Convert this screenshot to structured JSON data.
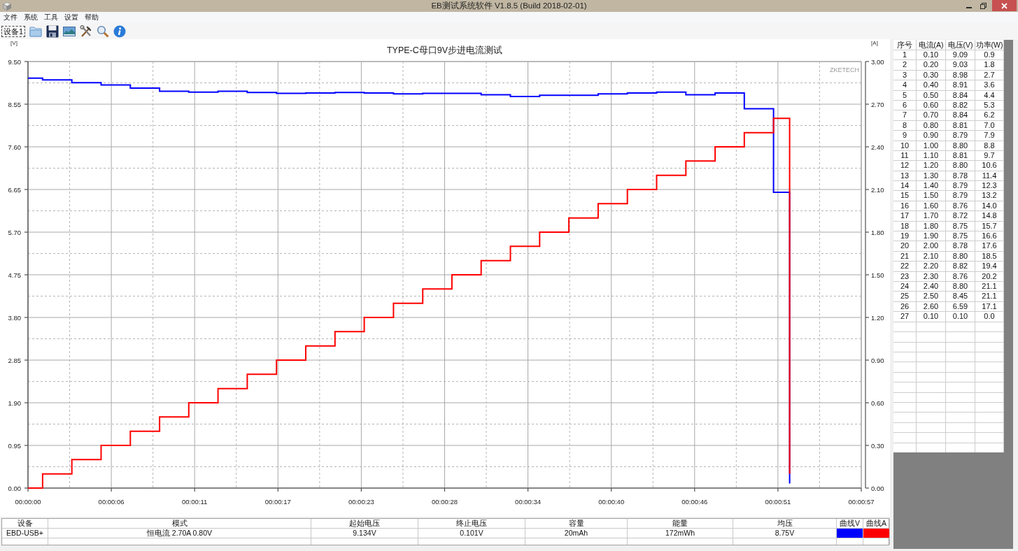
{
  "window": {
    "title": "EB测试系统软件 V1.8.5 (Build 2018-02-01)"
  },
  "menu": [
    "文件",
    "系统",
    "工具",
    "设置",
    "帮助"
  ],
  "toolbar": {
    "device_tab": "设备1"
  },
  "chart": {
    "brand_label": "ZKETECH",
    "chart_data": {
      "type": "line",
      "title": "TYPE-C母口9V步进电流测试",
      "ylabel": "[V]",
      "y2label": "[A]",
      "grid": true,
      "x": [
        0,
        1,
        1,
        3,
        3,
        5,
        5,
        7,
        7,
        9,
        9,
        11,
        11,
        13,
        13,
        15,
        15,
        17,
        17,
        19,
        19,
        21,
        21,
        23,
        23,
        25,
        25,
        27,
        27,
        29,
        29,
        31,
        31,
        33,
        33,
        35,
        35,
        37,
        37,
        39,
        39,
        41,
        41,
        43,
        43,
        45,
        45,
        47,
        47,
        49,
        49,
        51,
        51,
        52.1,
        52.1
      ],
      "series": [
        {
          "color": "#0000ff",
          "values": [
            9.13,
            9.13,
            9.09,
            9.09,
            9.03,
            9.03,
            8.98,
            8.98,
            8.91,
            8.91,
            8.84,
            8.84,
            8.82,
            8.82,
            8.84,
            8.84,
            8.81,
            8.81,
            8.79,
            8.79,
            8.8,
            8.8,
            8.81,
            8.81,
            8.8,
            8.8,
            8.78,
            8.78,
            8.79,
            8.79,
            8.79,
            8.79,
            8.76,
            8.76,
            8.72,
            8.72,
            8.75,
            8.75,
            8.75,
            8.75,
            8.78,
            8.78,
            8.8,
            8.8,
            8.82,
            8.82,
            8.76,
            8.76,
            8.8,
            8.8,
            8.45,
            8.45,
            6.59,
            6.59,
            0.1
          ]
        },
        {
          "color": "#ff0000",
          "axis": "y2",
          "values": [
            0,
            0,
            0.1,
            0.1,
            0.2,
            0.2,
            0.3,
            0.3,
            0.4,
            0.4,
            0.5,
            0.5,
            0.6,
            0.6,
            0.7,
            0.7,
            0.8,
            0.8,
            0.9,
            0.9,
            1,
            1,
            1.1,
            1.1,
            1.2,
            1.2,
            1.3,
            1.3,
            1.4,
            1.4,
            1.5,
            1.5,
            1.6,
            1.6,
            1.7,
            1.7,
            1.8,
            1.8,
            1.9,
            1.9,
            2,
            2,
            2.1,
            2.1,
            2.2,
            2.2,
            2.3,
            2.3,
            2.4,
            2.4,
            2.5,
            2.5,
            2.6,
            2.6,
            0.1
          ]
        }
      ],
      "xlim": [
        0,
        57
      ],
      "ylim": [
        0,
        9.5
      ],
      "y2lim": [
        0,
        3
      ],
      "xticks": [
        {
          "value": 0,
          "label": "00:00:00"
        },
        {
          "value": 5.7,
          "label": "00:00:06"
        },
        {
          "value": 11.4,
          "label": "00:00:11"
        },
        {
          "value": 17.1,
          "label": "00:00:17"
        },
        {
          "value": 22.8,
          "label": "00:00:23"
        },
        {
          "value": 28.5,
          "label": "00:00:28"
        },
        {
          "value": 34.2,
          "label": "00:00:34"
        },
        {
          "value": 39.9,
          "label": "00:00:40"
        },
        {
          "value": 45.6,
          "label": "00:00:46"
        },
        {
          "value": 51.3,
          "label": "00:00:51"
        },
        {
          "value": 57,
          "label": "00:00:57"
        }
      ],
      "yticks": [
        {
          "value": 0,
          "label": "0.00"
        },
        {
          "value": 0.95,
          "label": "0.95"
        },
        {
          "value": 1.9,
          "label": "1.90"
        },
        {
          "value": 2.85,
          "label": "2.85"
        },
        {
          "value": 3.8,
          "label": "3.80"
        },
        {
          "value": 4.75,
          "label": "4.75"
        },
        {
          "value": 5.7,
          "label": "5.70"
        },
        {
          "value": 6.65,
          "label": "6.65"
        },
        {
          "value": 7.6,
          "label": "7.60"
        },
        {
          "value": 8.55,
          "label": "8.55"
        },
        {
          "value": 9.5,
          "label": "9.50"
        }
      ],
      "y2ticks": [
        {
          "value": 0,
          "label": "0.00"
        },
        {
          "value": 0.3,
          "label": "0.30"
        },
        {
          "value": 0.6,
          "label": "0.60"
        },
        {
          "value": 0.9,
          "label": "0.90"
        },
        {
          "value": 1.2,
          "label": "1.20"
        },
        {
          "value": 1.5,
          "label": "1.50"
        },
        {
          "value": 1.8,
          "label": "1.80"
        },
        {
          "value": 2.1,
          "label": "2.10"
        },
        {
          "value": 2.4,
          "label": "2.40"
        },
        {
          "value": 2.7,
          "label": "2.70"
        },
        {
          "value": 3,
          "label": "3.00"
        }
      ]
    }
  },
  "readings_table": {
    "columns": [
      "序号",
      "电流(A)",
      "电压(V)",
      "功率(W)"
    ],
    "rows": [
      [
        "1",
        "0.10",
        "9.09",
        "0.9"
      ],
      [
        "2",
        "0.20",
        "9.03",
        "1.8"
      ],
      [
        "3",
        "0.30",
        "8.98",
        "2.7"
      ],
      [
        "4",
        "0.40",
        "8.91",
        "3.6"
      ],
      [
        "5",
        "0.50",
        "8.84",
        "4.4"
      ],
      [
        "6",
        "0.60",
        "8.82",
        "5.3"
      ],
      [
        "7",
        "0.70",
        "8.84",
        "6.2"
      ],
      [
        "8",
        "0.80",
        "8.81",
        "7.0"
      ],
      [
        "9",
        "0.90",
        "8.79",
        "7.9"
      ],
      [
        "10",
        "1.00",
        "8.80",
        "8.8"
      ],
      [
        "11",
        "1.10",
        "8.81",
        "9.7"
      ],
      [
        "12",
        "1.20",
        "8.80",
        "10.6"
      ],
      [
        "13",
        "1.30",
        "8.78",
        "11.4"
      ],
      [
        "14",
        "1.40",
        "8.79",
        "12.3"
      ],
      [
        "15",
        "1.50",
        "8.79",
        "13.2"
      ],
      [
        "16",
        "1.60",
        "8.76",
        "14.0"
      ],
      [
        "17",
        "1.70",
        "8.72",
        "14.8"
      ],
      [
        "18",
        "1.80",
        "8.75",
        "15.7"
      ],
      [
        "19",
        "1.90",
        "8.75",
        "16.6"
      ],
      [
        "20",
        "2.00",
        "8.78",
        "17.6"
      ],
      [
        "21",
        "2.10",
        "8.80",
        "18.5"
      ],
      [
        "22",
        "2.20",
        "8.82",
        "19.4"
      ],
      [
        "23",
        "2.30",
        "8.76",
        "20.2"
      ],
      [
        "24",
        "2.40",
        "8.80",
        "21.1"
      ],
      [
        "25",
        "2.50",
        "8.45",
        "21.1"
      ],
      [
        "26",
        "2.60",
        "6.59",
        "17.1"
      ],
      [
        "27",
        "0.10",
        "0.10",
        "0.0"
      ]
    ]
  },
  "summary_table": {
    "columns": [
      "设备",
      "模式",
      "起始电压",
      "终止电压",
      "容量",
      "能量",
      "均压"
    ],
    "curves": [
      {
        "label": "曲线V",
        "color": "#0000ff"
      },
      {
        "label": "曲线A",
        "color": "#ff0000"
      }
    ],
    "rows": [
      [
        "EBD-USB+",
        "恒电流 2.70A 0.80V",
        "9.134V",
        "0.101V",
        "20mAh",
        "172mWh",
        "8.75V"
      ]
    ]
  }
}
